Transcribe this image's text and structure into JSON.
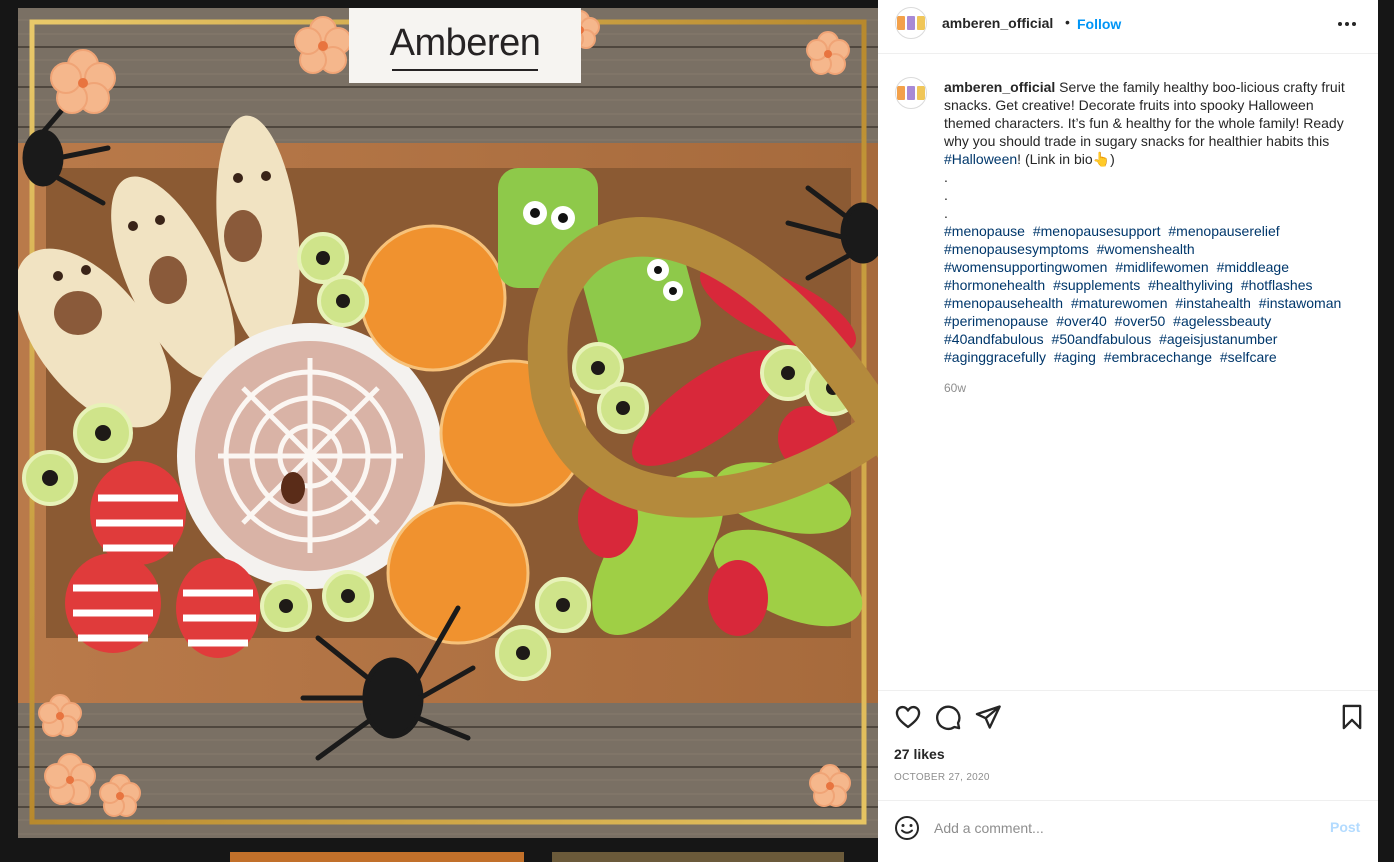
{
  "post": {
    "username": "amberen_official",
    "separator": "•",
    "follow_label": "Follow",
    "more_label": "More options",
    "brand_text": "Amberen",
    "caption_text": " Serve the family healthy boo-licious crafty fruit snacks. Get creative! Decorate fruits into spooky Halloween themed characters. It’s fun & healthy for the whole family! Ready why you should trade in sugary snacks for healthier habits this ",
    "caption_tag": "#Halloween",
    "caption_tail": "! (Link in bio👆)\n.\n.\n.",
    "hashtags": [
      "#menopause",
      "#menopausesupport",
      "#menopauserelief",
      "#menopausesymptoms",
      "#womenshealth",
      "#womensupportingwomen",
      "#midlifewomen",
      "#middleage",
      "#hormonehealth",
      "#supplements",
      "#healthyliving",
      "#hotflashes",
      "#menopausehealth",
      "#maturewomen",
      "#instahealth",
      "#instawoman",
      "#perimenopause",
      "#over40",
      "#over50",
      "#agelessbeauty",
      "#40andfabulous",
      "#50andfabulous",
      "#ageisjustanumber",
      "#aginggracefully",
      "#aging",
      "#embracechange",
      "#selfcare"
    ],
    "age": "60w",
    "likes": "27 likes",
    "date": "OCTOBER 27, 2020",
    "comment_placeholder": "Add a comment...",
    "post_label": "Post"
  },
  "icons": {
    "like": "heart-icon",
    "comment": "comment-icon",
    "share": "share-icon",
    "save": "bookmark-icon",
    "emoji": "emoji-icon",
    "more": "more-icon"
  },
  "colors": {
    "link": "#0095f6",
    "hashtag": "#00376b",
    "muted": "#8e8e8e",
    "post_disabled": "#b3dbff",
    "frame_gold": "#c9a23a"
  }
}
